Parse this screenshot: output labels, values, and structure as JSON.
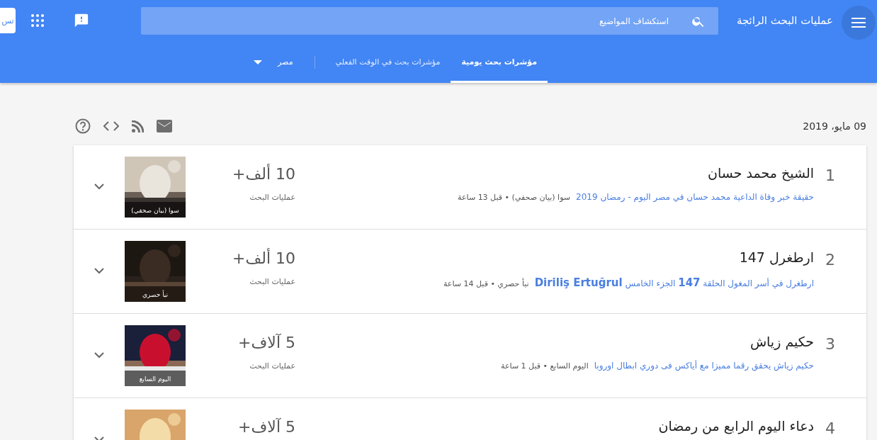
{
  "header": {
    "title": "عمليات البحث الرائجة",
    "search": {
      "placeholder": "استكشاف المواضيع"
    },
    "sign_in": "تس"
  },
  "tabs": [
    {
      "label": "مؤشرات بحث يومية",
      "selected": true
    },
    {
      "label": "مؤشرات بحث في الوقت الفعلي",
      "selected": false
    }
  ],
  "region": {
    "value": "مصر"
  },
  "date": "09 مايو، 2019",
  "trends": [
    {
      "rank": "1",
      "title": "الشيخ محمد حسان",
      "article": "حقيقة خبر وفاة الداعية محمد حسان في مصر اليوم - رمضان 2019",
      "meta": "سوا (بيان صحفي) • قبل 13 ساعة",
      "count": "10 ألف+",
      "count_label": "عمليات البحث",
      "caption": "سوا (بيان صحفي)",
      "expanded": false
    },
    {
      "rank": "2",
      "title": "ارطغرل 147",
      "article": "ارطغرل في أسر المغول الحلقة **147** الجزء الخامس **Diriliş Ertuğrul**",
      "meta": "نبأ حصري • قبل 14 ساعة",
      "count": "10 ألف+",
      "count_label": "عمليات البحث",
      "caption": "نبأ حصري",
      "expanded": false
    },
    {
      "rank": "3",
      "title": "حكيم زياش",
      "article": "حكيم زياش يحقق رقما مميزا مع أياكس فى دوري ابطال اوروبا",
      "meta": "اليوم السابع • قبل 1 ساعة",
      "count": "5 آلاف+",
      "count_label": "عمليات البحث",
      "caption": "اليوم السابع",
      "expanded": false
    },
    {
      "rank": "4",
      "title": "دعاء اليوم الرابع من رمضان",
      "count": "5 آلاف+",
      "expanded": false
    }
  ]
}
